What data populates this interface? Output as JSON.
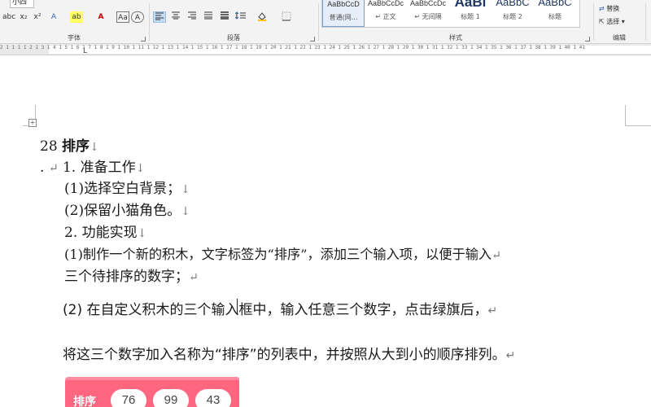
{
  "ribbon": {
    "font_size_value": "小四",
    "font_group_label": "字体",
    "paragraph_group_label": "段落",
    "styles_group_label": "样式",
    "editing_group_label": "编辑",
    "font_buttons": [
      "abc",
      "x₂",
      "x²",
      "A",
      "ab",
      "A",
      "Aa",
      "A"
    ],
    "styles": [
      {
        "sample": "AaBbCcD",
        "name": "普通(网..."
      },
      {
        "sample": "AaBbCcDc",
        "name": "↵ 正文"
      },
      {
        "sample": "AaBbCcDc",
        "name": "↵ 无间隔"
      },
      {
        "sample": "AaBl",
        "name": "标题 1"
      },
      {
        "sample": "AaBbC",
        "name": "标题 2"
      },
      {
        "sample": "AaBbC",
        "name": "标题"
      }
    ],
    "editing": {
      "replace": "替换",
      "select": "选择 ▾"
    }
  },
  "ruler": {
    "numbers": "2 1 1 1 1 2 1 3 1 4 1 5 1 6 1 7 1 8 1 9 1 10 1 11 1 12 1 13 1 14 1 15 1 16 1 17 1 18 1 19 1 20 1 21 1 22 1 23 1 24 1 25 1 26 1 27 1 28 1 29 1 30 1 31 1 32 1 33 1 34 1 35 1 36 1 37 1 38 1 39 1 40 1 41"
  },
  "document": {
    "heading_num": "28",
    "heading_title": "排序",
    "prep_title": "1. 准备工作",
    "prep_item1": "(1)选择空白背景；",
    "prep_item2": "(2)保留小猫角色。",
    "func_title": "2. 功能实现",
    "func_item1_line1": "(1)制作一个新的积木，文字标签为“排序”，添加三个输入项，以便于输入",
    "func_item1_line2": "三个待排序的数字；",
    "func_item2": "(2) 在自定义积木的三个输入框中，输入任意三个数字，点击绿旗后，",
    "func_item2_cont": "将这三个数字加入名称为“排序”的列表中，并按照从大到小的顺序排列。",
    "para_mark": "↵",
    "arrow_mark": "↓",
    "bullet_dot": "."
  },
  "block": {
    "label": "排序",
    "inputs": [
      "76",
      "99",
      "43"
    ],
    "color": "#ff6680"
  }
}
